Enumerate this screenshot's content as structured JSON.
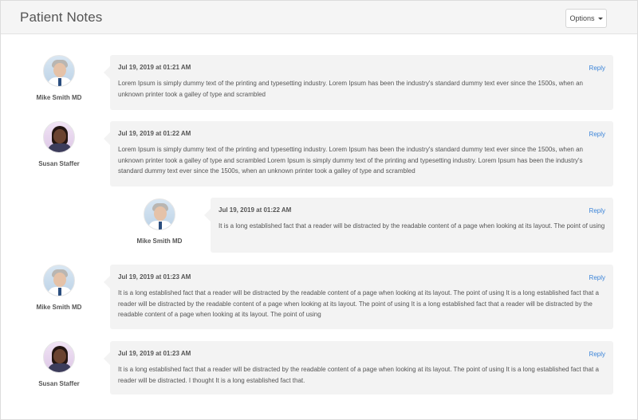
{
  "header": {
    "title": "Patient Notes",
    "options_label": "Options"
  },
  "notes": [
    {
      "author": "Mike Smith MD",
      "avatar": "doctor-avatar",
      "date": "Jul 19, 2019 at 01:21 AM",
      "reply_label": "Reply",
      "text": "Lorem Ipsum is simply dummy text of the printing and typesetting industry. Lorem Ipsum has been the industry's standard dummy text ever since the 1500s, when an unknown printer took a galley of type and scrambled"
    },
    {
      "author": "Susan Staffer",
      "avatar": "staff-avatar",
      "date": "Jul 19, 2019 at 01:22 AM",
      "reply_label": "Reply",
      "text": "Lorem Ipsum is simply dummy text of the printing and typesetting industry. Lorem Ipsum has been the industry's standard dummy text ever since the 1500s, when an unknown printer took a galley of type and scrambled Lorem Ipsum is simply dummy text of the printing and typesetting industry. Lorem Ipsum has been the industry's standard dummy text ever since the 1500s, when an unknown printer took a galley of type and scrambled"
    },
    {
      "author": "Mike Smith MD",
      "avatar": "doctor-avatar",
      "date": "Jul 19, 2019 at 01:22 AM",
      "reply_label": "Reply",
      "text": "It is a long established fact that a reader will be distracted by the readable content of a page when looking at its layout. The point of using"
    },
    {
      "author": "Mike Smith MD",
      "avatar": "doctor-avatar",
      "date": "Jul 19, 2019 at 01:23 AM",
      "reply_label": "Reply",
      "text": "It is a long established fact that a reader will be distracted by the readable content of a page when looking at its layout. The point of using It is a long established fact that a reader will be distracted by the readable content of a page when looking at its layout. The point of using It is a long established fact that a reader will be distracted by the readable content of a page when looking at its layout. The point of using"
    },
    {
      "author": "Susan Staffer",
      "avatar": "staff-avatar",
      "date": "Jul 19, 2019 at 01:23 AM",
      "reply_label": "Reply",
      "text": "It is a long established fact that a reader will be distracted by the readable content of a page when looking at its layout. The point of using It is a long established fact that a reader will be distracted. I thought It is a long established fact that."
    }
  ]
}
